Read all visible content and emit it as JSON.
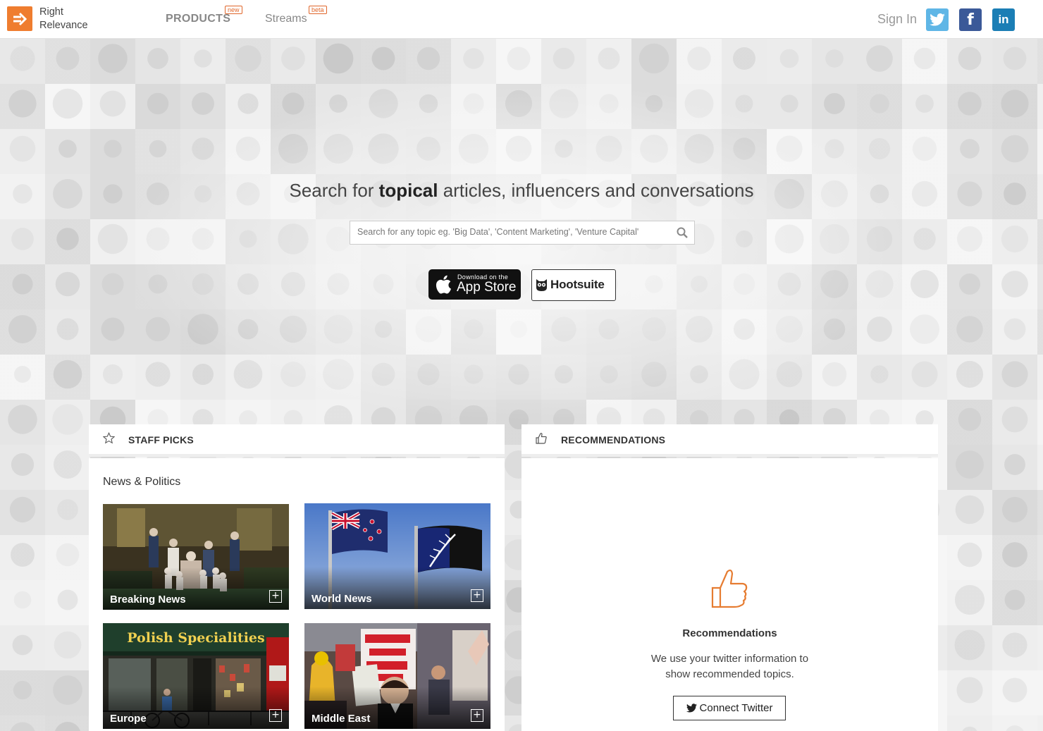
{
  "header": {
    "logo_line1": "Right",
    "logo_line2": "Relevance",
    "nav": [
      {
        "label": "PRODUCTS",
        "tag": "new"
      },
      {
        "label": "Streams",
        "tag": "beta"
      }
    ],
    "sign_in": "Sign In",
    "social": [
      "twitter-icon",
      "facebook-icon",
      "linkedin-icon"
    ]
  },
  "hero": {
    "headline_pre": "Search for ",
    "headline_bold": "topical",
    "headline_post": " articles, influencers and conversations",
    "search_placeholder": "Search for any topic eg. 'Big Data', 'Content Marketing', 'Venture Capital'",
    "appstore_small": "Download on the",
    "appstore_big": "App Store",
    "hootsuite_label": "Hootsuite"
  },
  "staff_picks": {
    "title": "STAFF PICKS",
    "section": "News & Politics",
    "cards": [
      {
        "label": "Breaking News"
      },
      {
        "label": "World News"
      },
      {
        "label": "Europe"
      },
      {
        "label": "Middle East"
      }
    ],
    "polish_sign": "Polish Specialities"
  },
  "recommendations": {
    "title": "RECOMMENDATIONS",
    "heading": "Recommendations",
    "description": "We use your twitter information to show recommended topics.",
    "button": "Connect Twitter"
  },
  "colors": {
    "brand_orange": "#ef7d2f",
    "twitter": "#5fb6e6",
    "facebook": "#3b5998",
    "linkedin": "#1b7eb5"
  }
}
